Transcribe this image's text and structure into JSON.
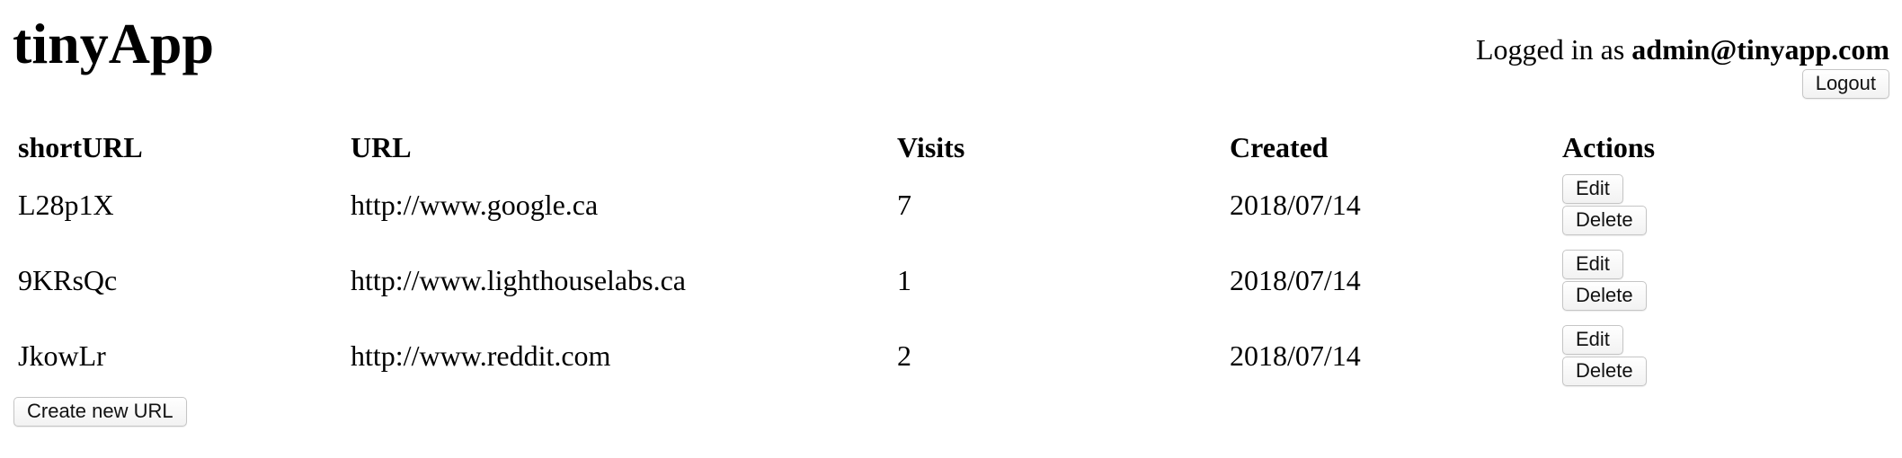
{
  "header": {
    "title": "tinyApp",
    "login_prefix": "Logged in as",
    "user_email": "admin@tinyapp.com",
    "logout_label": "Logout"
  },
  "table": {
    "columns": [
      "shortURL",
      "URL",
      "Visits",
      "Created",
      "Actions"
    ],
    "rows": [
      {
        "short_url": "L28p1X",
        "url": "http://www.google.ca",
        "visits": "7",
        "created": "2018/07/14",
        "edit_label": "Edit",
        "delete_label": "Delete"
      },
      {
        "short_url": "9KRsQc",
        "url": "http://www.lighthouselabs.ca",
        "visits": "1",
        "created": "2018/07/14",
        "edit_label": "Edit",
        "delete_label": "Delete"
      },
      {
        "short_url": "JkowLr",
        "url": "http://www.reddit.com",
        "visits": "2",
        "created": "2018/07/14",
        "edit_label": "Edit",
        "delete_label": "Delete"
      }
    ]
  },
  "create_label": "Create new URL"
}
